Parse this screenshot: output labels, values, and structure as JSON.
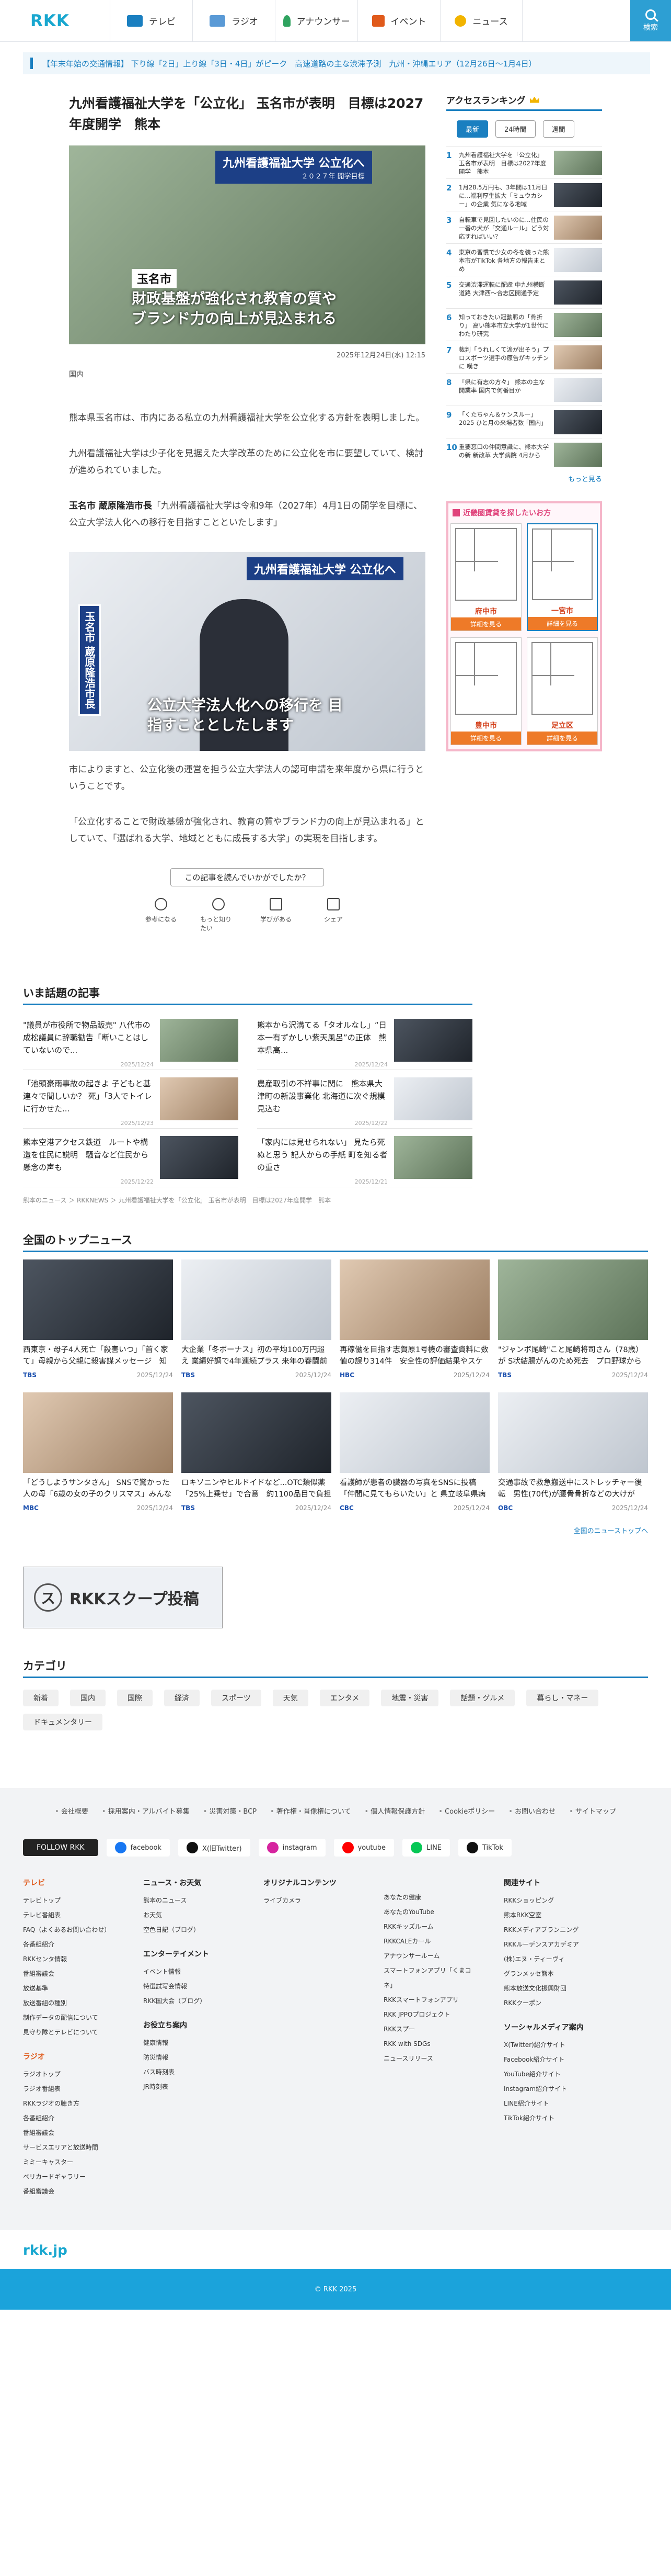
{
  "header": {
    "logo": "RKK",
    "nav": [
      {
        "label": "テレビ",
        "icon": "tv-icon",
        "color": "#1a7fc0"
      },
      {
        "label": "ラジオ",
        "icon": "radio-icon",
        "color": "#1a7fc0"
      },
      {
        "label": "アナウンサー",
        "icon": "announcer-icon",
        "color": "#2fa35f"
      },
      {
        "label": "イベント",
        "icon": "event-icon",
        "color": "#e05a1b"
      },
      {
        "label": "ニュース",
        "icon": "news-icon",
        "color": "#f2b400"
      }
    ],
    "search_label": "検索"
  },
  "ticker": {
    "text": "【年末年始の交通情報】 下り線「2日」上り線「3日・4日」がピーク　高速道路の主な渋滞予測　九州・沖縄エリア（12月26日〜1月4日）"
  },
  "article": {
    "title": "九州看護福祉大学を「公立化」 玉名市が表明　目標は2027年度開学　熊本",
    "hero_caption_main": "九州看護福祉大学 公立化へ",
    "hero_caption_small": "２０２７年 開学目標",
    "hero_place": "玉名市",
    "hero_subtitle": "財政基盤が強化され教育の質や ブランド力の向上が見込まれる",
    "date": "2025年12月24日(水) 12:15",
    "category": "国内",
    "p1": "熊本県玉名市は、市内にある私立の九州看護福祉大学を公立化する方針を表明しました。",
    "p2": "九州看護福祉大学は少子化を見据えた大学改革のために公立化を市に要望していて、検討が進められていました。",
    "p3_name": "玉名市 蔵原隆浩市長",
    "p3": "「九州看護福祉大学は令和9年（2027年）4月1日の開学を目標に、公立大学法人化への移行を目指すことといたします」",
    "photo2_caption": "九州看護福祉大学 公立化へ",
    "photo2_name": "玉名市 蔵原隆浩市長",
    "photo2_subtitle": "公立大学法人化への移行を 目指すこととしたします",
    "p4": "市によりますと、公立化後の運営を担う公立大学法人の認可申請を来年度から県に行うということです。",
    "p5": "「公立化することで財政基盤が強化され、教育の質やブランド力の向上が見込まれる」としていて、「選ばれる大学、地域とともに成長する大学」の実現を目指します。"
  },
  "survey": {
    "question": "この記事を読んでいかがでしたか？",
    "reactions": [
      "参考になる",
      "もっと知りたい",
      "学びがある",
      "シェア"
    ]
  },
  "ranking": {
    "title": "アクセスランキング",
    "tabs": [
      "最新",
      "24時間",
      "週間"
    ],
    "items": [
      "九州看護福祉大学を「公立化」 玉名市が表明　目標は2027年度開学　熊本",
      "1月28.5万円も、3年間は11月日に...福利厚生拡大「ミュウカシー」の企業 気になる地域",
      "自転車で見回したいのに...住民の一番の犬が「交通ルール」どう対応すればいい？",
      "東京の習慣で少女の冬を装った熊本市がTikTok 各地方の報告まとめ",
      "交通渋滞運転に配慮 中九州横断道路 大津西〜合志区開通予定",
      "知っておきたい冠動脈の「骨折り」 高い熊本市立大学が1世代にわたり研究",
      "裁判「うれしくて涙が出そう」プロスポーツ選手の原告がキッチンに 嘆き",
      "「県に有志の方々」 熊本の主な 開業率 国内で何番目か",
      "「くたちゃん＆ケンスルー」2025 ひと月の来場者数 ｢国内｣",
      "重要窓口の仲間意識に、熊本大学の新 新改革 大学病院 4月から"
    ],
    "more": "もっと見る"
  },
  "ad": {
    "title": "近畿圏賃貸を探したいお方",
    "items": [
      {
        "name": "府中市",
        "button": "詳細を見る"
      },
      {
        "name": "一宮市",
        "button": "詳細を見る"
      },
      {
        "name": "豊中市",
        "button": "詳細を見る"
      },
      {
        "name": "足立区",
        "button": "詳細を見る"
      }
    ]
  },
  "topics": {
    "title": "いま話題の記事",
    "items": [
      {
        "title": "\"議員が市役所で物品販売\" 八代市の成松議員に辞職勧告「断いことはしていないので...",
        "time": "2025/12/24"
      },
      {
        "title": "熊本から沢満てる「タオルなし」“日本一有ずかしい紫天風呂”の正体　熊本県高...",
        "time": "2025/12/24"
      },
      {
        "title": "「池頭豪雨事故の起きよ 子どもと基連々で間しいか？ 死」「3人でトイレに行かせた...",
        "time": "2025/12/23"
      },
      {
        "title": "農産取引の不祥事に関に　熊本県大津町の新設事業化 北海道に次ぐ規模見込む",
        "time": "2025/12/22"
      },
      {
        "title": "熊本空港アクセス鉄道　ルートや構造を住民に説明　騒音など住民から懸念の声も",
        "time": "2025/12/22"
      },
      {
        "title": "「家内には見せられない」 見たら死ぬと思う 記人からの手紙 町を知る者の重さ",
        "time": "2025/12/21"
      }
    ]
  },
  "breadcrumb": "熊本のニュース ＞ RKKNEWS ＞ 九州看護福祉大学を「公立化」 玉名市が表明　目標は2027年度開学　熊本",
  "national": {
    "title": "全国のトップニュース",
    "items": [
      {
        "title": "西東京・母子4人死亡「殺害いつ」「首く家て」母親から父親に殺害謀メッセージ　知人男性も遺体で発見...",
        "src": "TBS",
        "time": "2025/12/24"
      },
      {
        "title": "大企業「冬ボーナス」初の平均100万円超え 業績好調で4年連続プラス 来年の春闘前に賃上げの動き",
        "src": "TBS",
        "time": "2025/12/24"
      },
      {
        "title": "再稼働を目指す志賀原1号機の審査資料に数値の誤り314件　安全性の評価結果やスケジュールに影響なし　北...",
        "src": "HBC",
        "time": "2025/12/24"
      },
      {
        "title": "\"ジャンボ尾崎\"こと尾崎将司さん（78歳）が S状結腸がんのため死去　プロ野球からゴルファーに転身し国内ツア...",
        "src": "TBS",
        "time": "2025/12/24"
      },
      {
        "title": "「どうしようサンタさん」 SNSで驚かった人の母「6歳の女の子のクリスマス」みんなで作った魔法",
        "src": "MBC",
        "time": "2025/12/24"
      },
      {
        "title": "ロキソニンやヒルドイドなど...OTC類似薬「25%上乗せ」で合意　約1100品目で負担増",
        "src": "TBS",
        "time": "2025/12/24"
      },
      {
        "title": "看護師が患者の臓器の写真をSNSに投稿「仲間に見てもらいたい」と 県立岐阜県病院が口頭で注意 岐阜・大垣...",
        "src": "CBC",
        "time": "2025/12/24"
      },
      {
        "title": "交通事故で救急搬送中にストレッチャー後転　男性(70代)が腰骨骨折などの大けが「地面の状況確認が不十分...",
        "src": "OBC",
        "time": "2025/12/24"
      }
    ],
    "more": "全国のニューストップへ"
  },
  "scoop": {
    "label": "RKKスクープ投稿"
  },
  "category": {
    "title": "カテゴリ",
    "items": [
      "新着",
      "国内",
      "国際",
      "経済",
      "スポーツ",
      "天気",
      "エンタメ",
      "地震・災害",
      "話題・グルメ",
      "暮らし・マネー",
      "ドキュメンタリー"
    ]
  },
  "footer": {
    "links": [
      "会社概要",
      "採用案内・アルバイト募集",
      "災害対策・BCP",
      "著作権・肖像権について",
      "個人情報保護方針",
      "Cookieポリシー",
      "お問い合わせ",
      "サイトマップ"
    ],
    "follow": "FOLLOW RKK",
    "social": [
      {
        "name": "facebook",
        "color": "#1877f2"
      },
      {
        "name": "X(旧Twitter)",
        "color": "#111111"
      },
      {
        "name": "instagram",
        "color": "#d6249f"
      },
      {
        "name": "youtube",
        "color": "#ff0000"
      },
      {
        "name": "LINE",
        "color": "#06c755"
      },
      {
        "name": "TikTok",
        "color": "#111111"
      }
    ],
    "col1_title": "テレビ",
    "col1": [
      "テレビトップ",
      "テレビ番組表",
      "FAQ（よくあるお問い合わせ）",
      "各番組紹介",
      "RKKセンタ情報",
      "番組審議会",
      "放送基準",
      "放送番組の種別",
      "制作データの配信について",
      "見守り隊とテレビについて"
    ],
    "col1b_title": "ラジオ",
    "col1b": [
      "ラジオトップ",
      "ラジオ番組表",
      "RKKラジオの聴き方",
      "各番組紹介",
      "番組審議会",
      "サービスエリアと放送時間",
      "ミミーキャスター",
      "ベリカードギャラリー",
      "番組審議会"
    ],
    "col2_title": "ニュース・お天気",
    "col2": [
      "熊本のニュース",
      "お天気",
      "空色日記（ブログ）"
    ],
    "col2b_title": "エンターテイメント",
    "col2b": [
      "イベント情報",
      "特選試写会情報",
      "RKK国大会（ブログ）"
    ],
    "col2c_title": "お役立ち案内",
    "col2c": [
      "健康情報",
      "防災情報",
      "バス時刻表",
      "JR時刻表"
    ],
    "col3_title": "オリジナルコンテンツ",
    "col3": [
      "ライブカメラ"
    ],
    "col4": [
      "あなたの健康",
      "あなたのYouTube",
      "RKKキッズルーム",
      "RKKCALEカール",
      "アナウンサールーム",
      "スマートフォンアプリ「くまコネ」",
      "RKKスマートフォンアプリ",
      "RKK JPPOプロジェクト",
      "RKKスプー",
      "RKK with SDGs",
      "ニュースリリース"
    ],
    "col5_title": "関連サイト",
    "col5": [
      "RKKショッピング",
      "熊本RKK空室",
      "RKKメディアプランニング",
      "RKKルーデンスアカデミア",
      "(株)エヌ・ティーヴィ",
      "グランメッセ熊本",
      "熊本放送文化振興財団",
      "RKKクーポン"
    ],
    "col5b_title": "ソーシャルメディア案内",
    "col5b": [
      "X(Twitter)紹介サイト",
      "Facebook紹介サイト",
      "YouTube紹介サイト",
      "Instagram紹介サイト",
      "LINE紹介サイト",
      "TikTok紹介サイト"
    ],
    "logo": "rkk.jp",
    "copyright": "© RKK 2025"
  }
}
